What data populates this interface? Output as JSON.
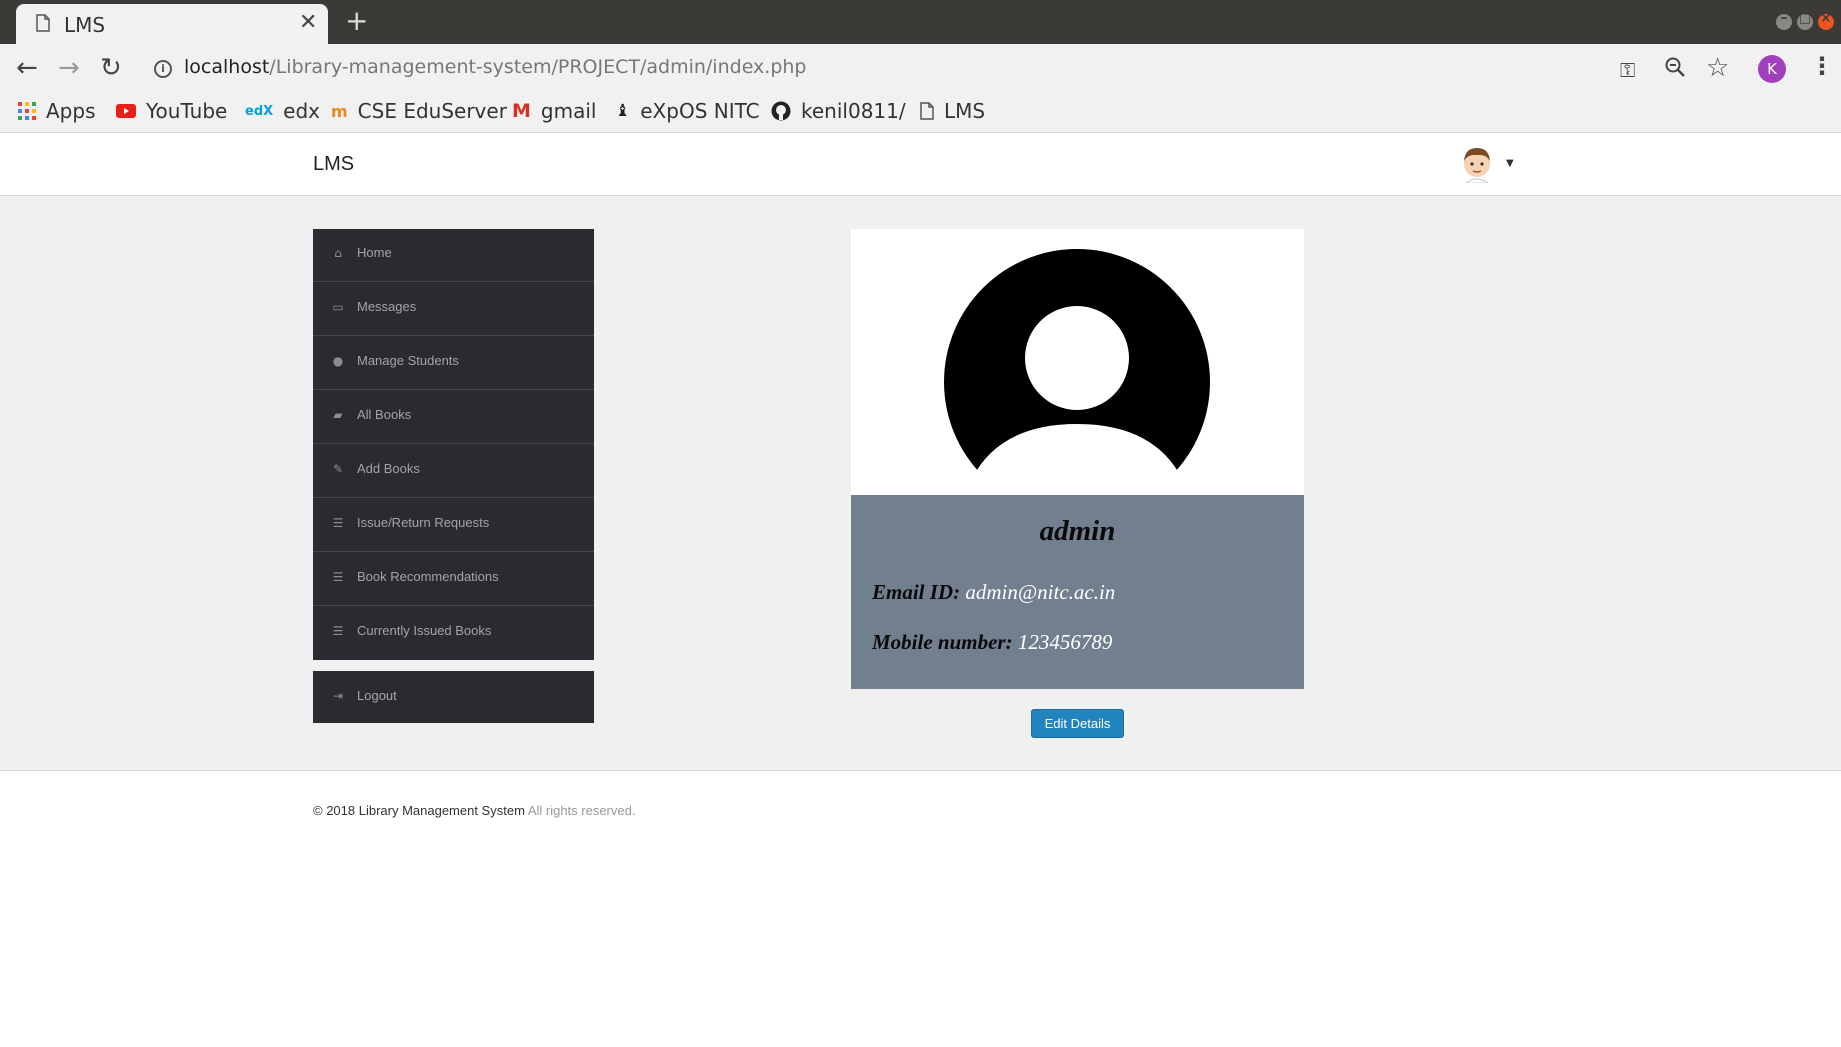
{
  "browser": {
    "tab_title": "LMS",
    "new_tab": "+",
    "url_host": "localhost",
    "url_path": "/Library-management-system/PROJECT/admin/index.php",
    "profile_initial": "K",
    "bookmarks": [
      {
        "label": "Apps",
        "icon": "apps-grid-icon"
      },
      {
        "label": "YouTube",
        "icon": "youtube-icon"
      },
      {
        "label": "edx",
        "icon": "edx-icon"
      },
      {
        "label": "CSE EduServer",
        "icon": "eduserver-icon"
      },
      {
        "label": "gmail",
        "icon": "gmail-icon"
      },
      {
        "label": "eXpOS NITC",
        "icon": "expos-icon"
      },
      {
        "label": "kenil0811/",
        "icon": "github-icon"
      },
      {
        "label": "LMS",
        "icon": "file-icon"
      }
    ]
  },
  "header": {
    "brand": "LMS"
  },
  "sidebar": {
    "items": [
      {
        "label": "Home",
        "icon": "home-icon"
      },
      {
        "label": "Messages",
        "icon": "inbox-icon"
      },
      {
        "label": "Manage Students",
        "icon": "user-icon"
      },
      {
        "label": "All Books",
        "icon": "book-icon"
      },
      {
        "label": "Add Books",
        "icon": "edit-icon"
      },
      {
        "label": "Issue/Return Requests",
        "icon": "list-alt-icon"
      },
      {
        "label": "Book Recommendations",
        "icon": "list-icon"
      },
      {
        "label": "Currently Issued Books",
        "icon": "list-icon"
      }
    ],
    "logout": {
      "label": "Logout",
      "icon": "sign-out-icon"
    }
  },
  "profile": {
    "name": "admin",
    "email_label": "Email ID:",
    "email": "admin@nitc.ac.in",
    "mobile_label": "Mobile number:",
    "mobile": "123456789",
    "edit_button": "Edit Details"
  },
  "footer": {
    "copyright": "© 2018 Library Management System",
    "rights": "All rights reserved."
  },
  "colors": {
    "sidebar_bg": "#2b2a30",
    "profile_info_bg": "#727f8e",
    "button_bg": "#2184be",
    "page_bg": "#f0f0f0"
  }
}
